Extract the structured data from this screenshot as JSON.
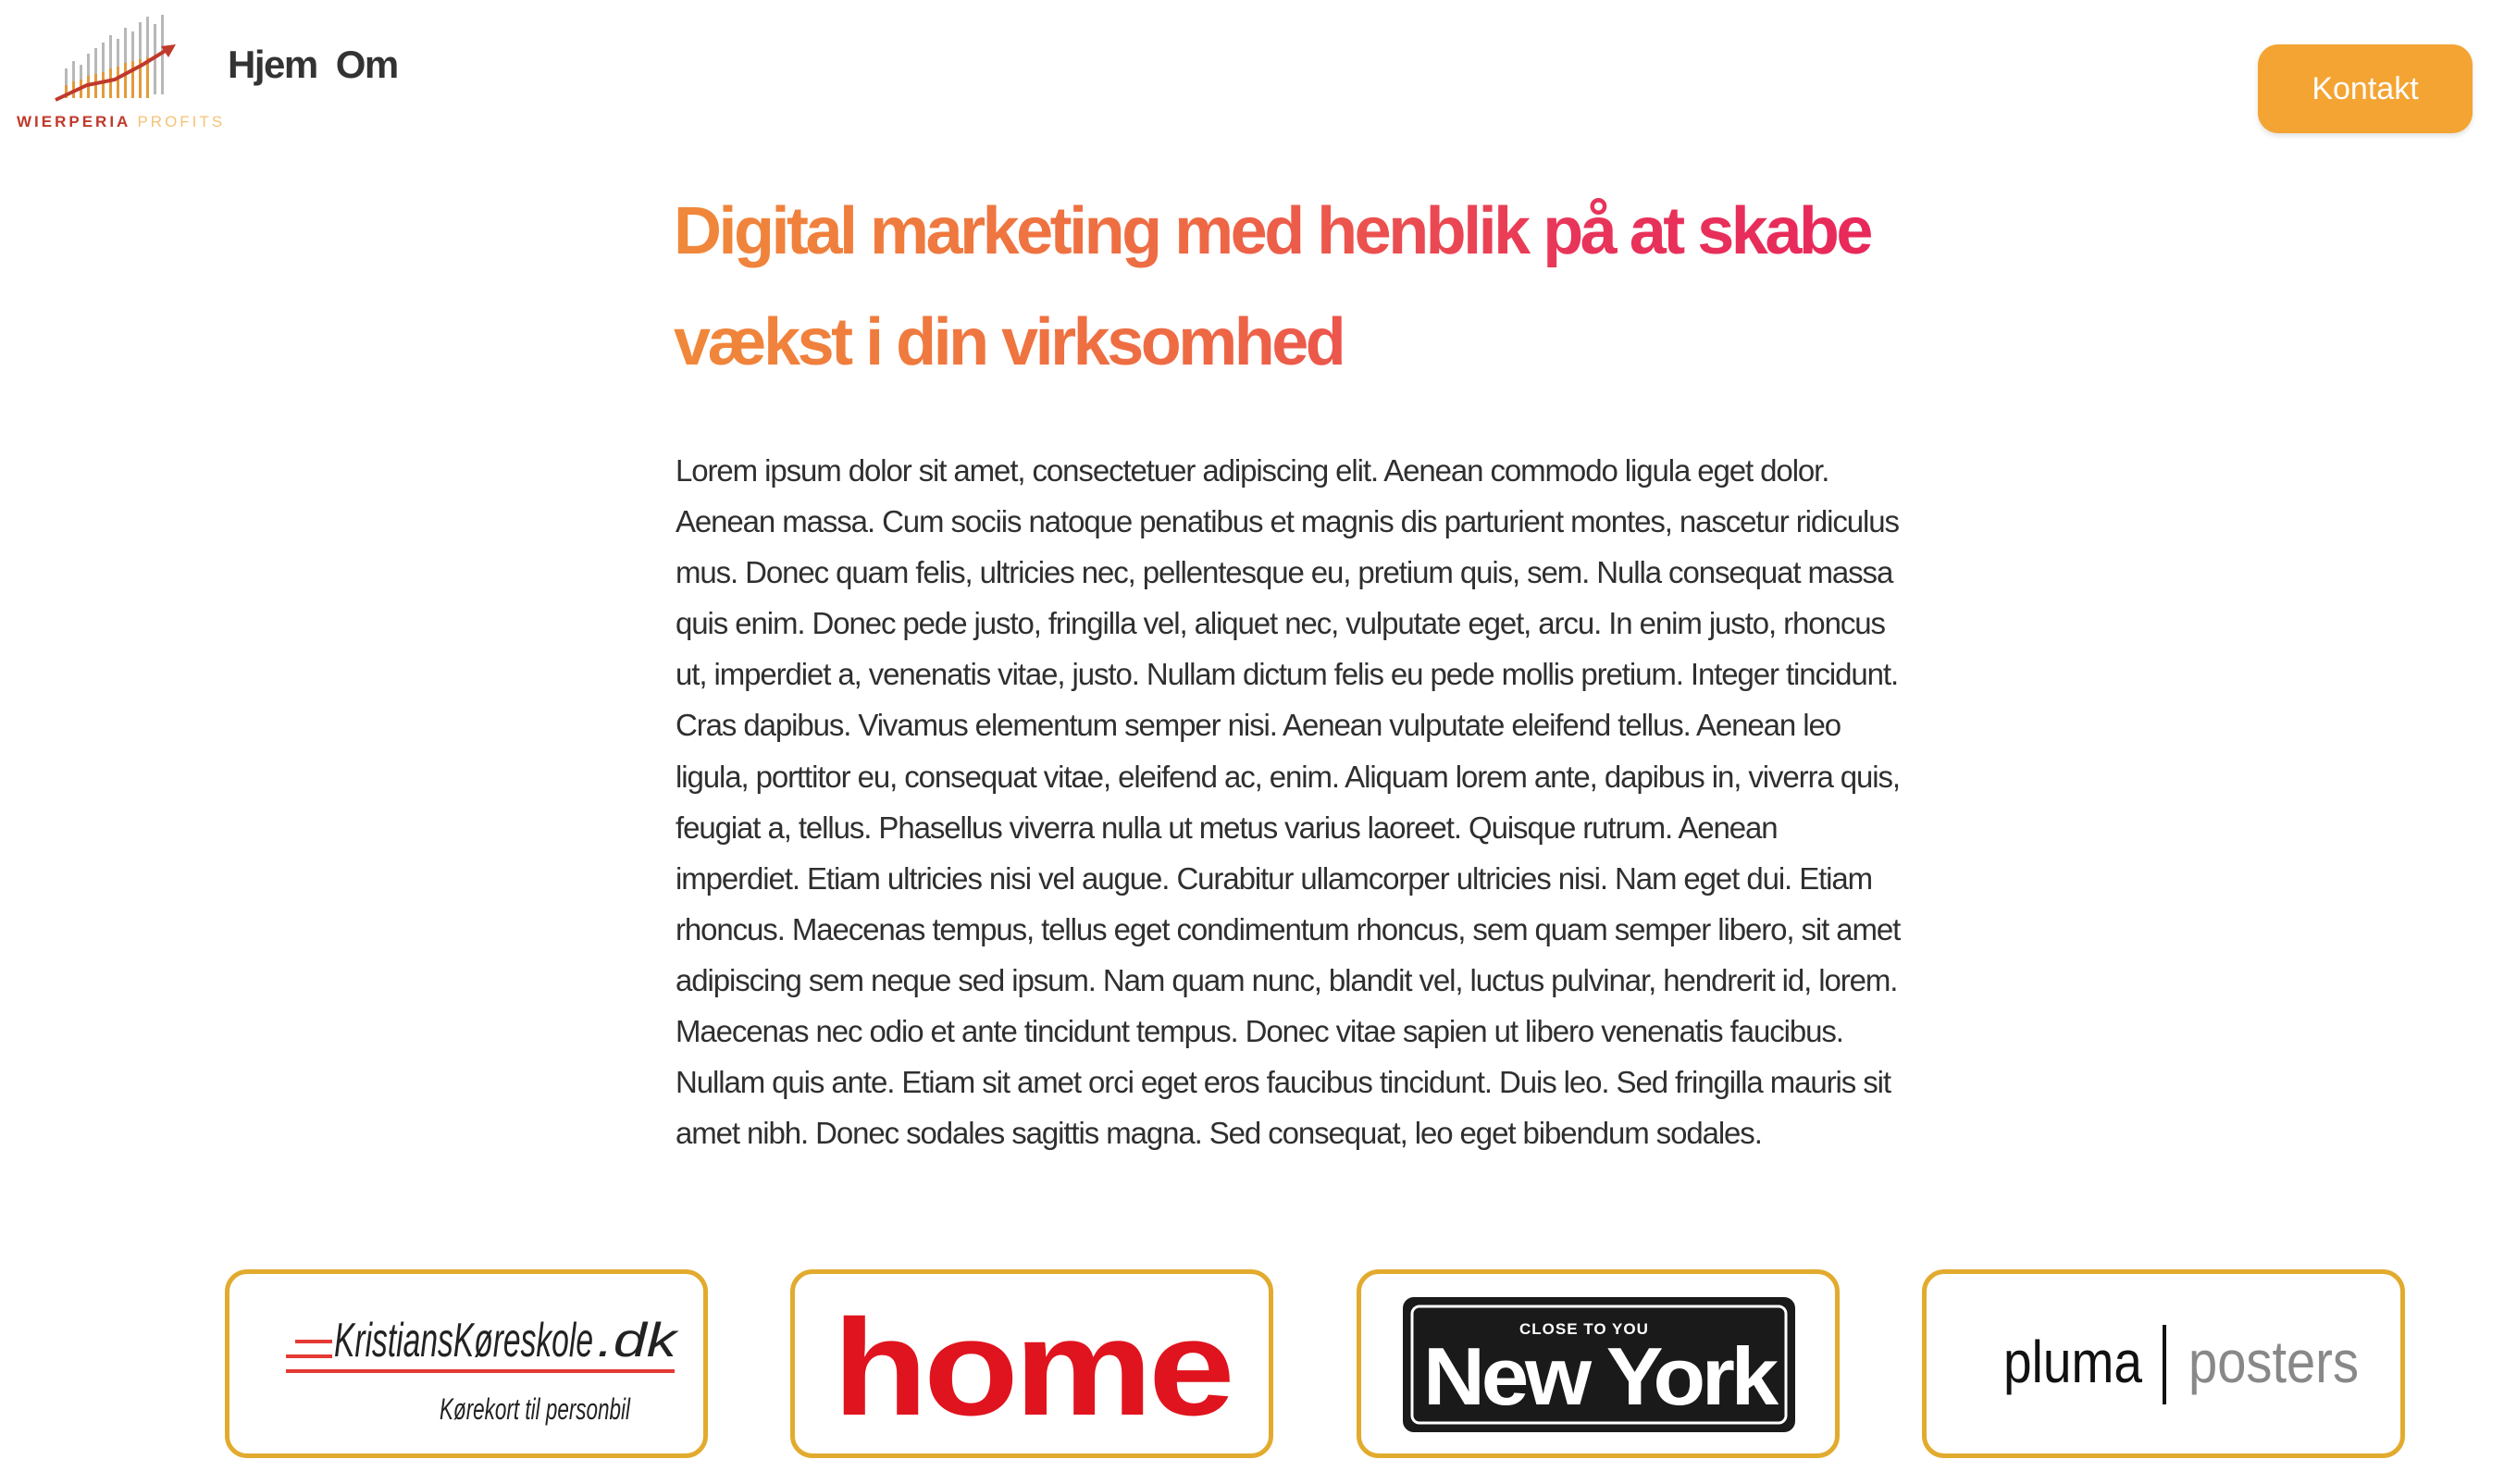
{
  "header": {
    "logo": {
      "brand_word_1": "WIERPERIA",
      "brand_word_2": "PROFITS",
      "icon": "growth-chart-logo"
    },
    "nav": [
      {
        "label": "Hjem"
      },
      {
        "label": "Om"
      }
    ],
    "cta_label": "Kontakt"
  },
  "hero": {
    "title_line_1": "Digital marketing med henblik på at skabe",
    "title_line_2": "vækst i din virksomhed",
    "body": "Lorem ipsum dolor sit amet, consectetuer adipiscing elit. Aenean commodo ligula eget dolor. Aenean massa. Cum sociis natoque penatibus et magnis dis parturient montes, nascetur ridiculus mus. Donec quam felis, ultricies nec, pellentesque eu, pretium quis, sem. Nulla consequat massa quis enim. Donec pede justo, fringilla vel, aliquet nec, vulputate eget, arcu. In enim justo, rhoncus ut, imperdiet a, venenatis vitae, justo. Nullam dictum felis eu pede mollis pretium. Integer tincidunt. Cras dapibus. Vivamus elementum semper nisi. Aenean vulputate eleifend tellus. Aenean leo ligula, porttitor eu, consequat vitae, eleifend ac, enim. Aliquam lorem ante, dapibus in, viverra quis, feugiat a, tellus. Phasellus viverra nulla ut metus varius laoreet. Quisque rutrum. Aenean imperdiet. Etiam ultricies nisi vel augue. Curabitur ullamcorper ultricies nisi. Nam eget dui. Etiam rhoncus. Maecenas tempus, tellus eget condimentum rhoncus, sem quam semper libero, sit amet adipiscing sem neque sed ipsum. Nam quam nunc, blandit vel, luctus pulvinar, hendrerit id, lorem. Maecenas nec odio et ante tincidunt tempus. Donec vitae sapien ut libero venenatis faucibus. Nullam quis ante. Etiam sit amet orci eget eros faucibus tincidunt. Duis leo. Sed fringilla mauris sit amet nibh. Donec sodales sagittis magna. Sed consequat, leo eget bibendum sodales."
  },
  "clients": [
    {
      "name_main": "KristiansKøreskole",
      "name_suffix": ".dk",
      "tagline": "Kørekort til personbil"
    },
    {
      "name": "home"
    },
    {
      "small": "CLOSE TO YOU",
      "name": "New York"
    },
    {
      "name_left": "pluma",
      "name_right": "posters"
    }
  ],
  "colors": {
    "accent_orange": "#f4a433",
    "card_border": "#e2ab2e",
    "headline_start": "#f0883a",
    "headline_end": "#e8245a",
    "home_red": "#e0141e"
  }
}
